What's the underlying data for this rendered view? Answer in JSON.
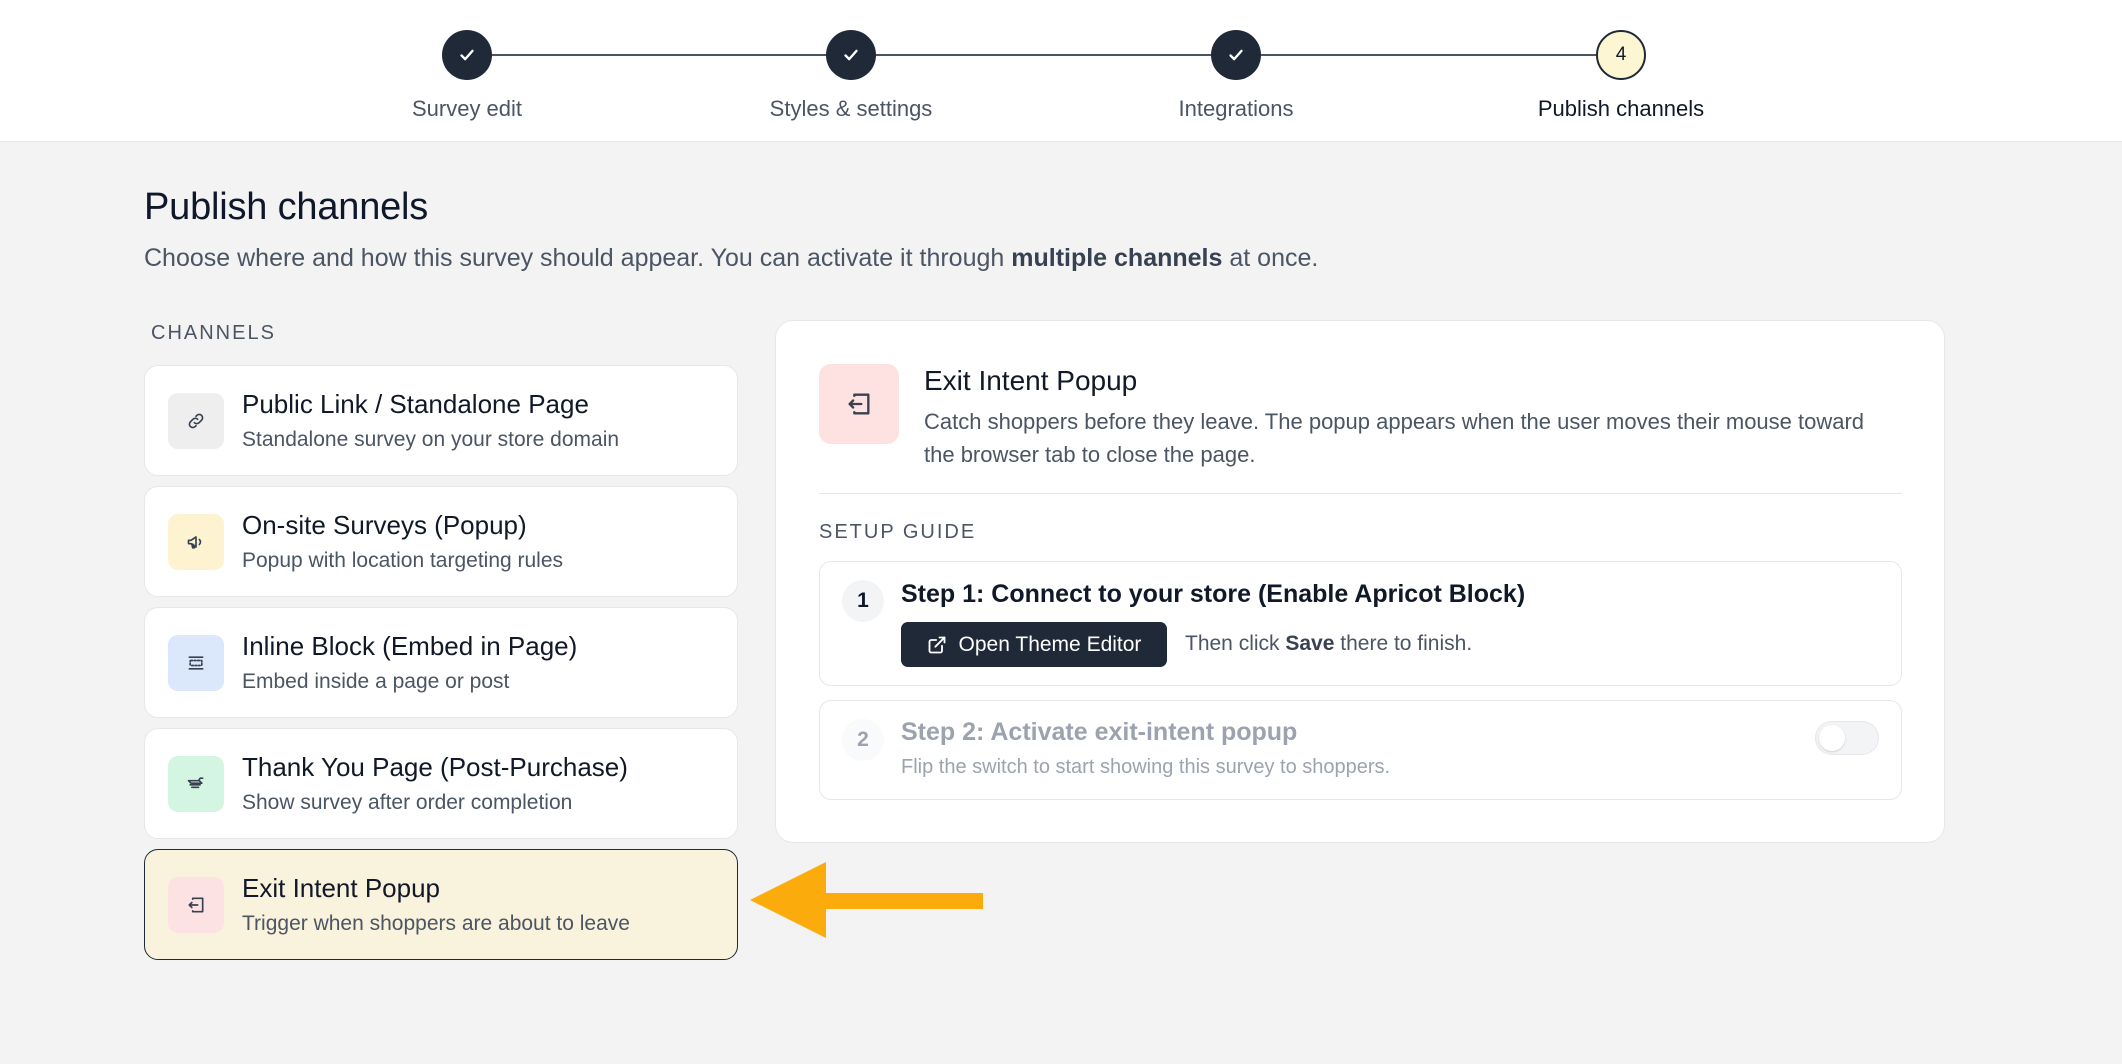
{
  "stepper": {
    "steps": [
      {
        "label": "Survey edit",
        "state": "done"
      },
      {
        "label": "Styles & settings",
        "state": "done"
      },
      {
        "label": "Integrations",
        "state": "done"
      },
      {
        "label": "Publish channels",
        "state": "current",
        "number": "4"
      }
    ]
  },
  "page": {
    "title": "Publish channels",
    "subtitle_before": "Choose where and how this survey should appear. You can activate it through ",
    "subtitle_bold": "multiple channels",
    "subtitle_after": " at once."
  },
  "channels": {
    "heading": "CHANNELS",
    "items": [
      {
        "title": "Public Link / Standalone Page",
        "desc": "Standalone survey on your store domain",
        "icon": "link-icon",
        "icon_bg": "#eeeeee",
        "icon_color": "#374151"
      },
      {
        "title": "On-site Surveys (Popup)",
        "desc": "Popup with location targeting rules",
        "icon": "megaphone-icon",
        "icon_bg": "#fdf3d0",
        "icon_color": "#374151"
      },
      {
        "title": "Inline Block (Embed in Page)",
        "desc": "Embed inside a page or post",
        "icon": "embed-icon",
        "icon_bg": "#dbe7fb",
        "icon_color": "#374151"
      },
      {
        "title": "Thank You Page (Post-Purchase)",
        "desc": "Show survey after order completion",
        "icon": "receipt-icon",
        "icon_bg": "#d5f5e3",
        "icon_color": "#374151"
      },
      {
        "title": "Exit Intent Popup",
        "desc": "Trigger when shoppers are about to leave",
        "icon": "exit-icon",
        "icon_bg": "#fde2e4",
        "icon_color": "#374151",
        "selected": true
      }
    ]
  },
  "panel": {
    "title": "Exit Intent Popup",
    "desc": "Catch shoppers before they leave. The popup appears when the user moves their mouse toward the browser tab to close the page.",
    "setup_heading": "SETUP GUIDE",
    "step1": {
      "number": "1",
      "title": "Step 1: Connect to your store (Enable Apricot Block)",
      "button_label": "Open Theme Editor",
      "hint_before": "Then click ",
      "hint_bold": "Save",
      "hint_after": " there to finish."
    },
    "step2": {
      "number": "2",
      "title": "Step 2: Activate exit-intent popup",
      "desc": "Flip the switch to start showing this survey to shoppers.",
      "toggle_on": false
    }
  },
  "colors": {
    "dark": "#1f2937",
    "accent_arrow": "#fbab0c",
    "selected_bg": "#f9f2dc",
    "current_step_bg": "#fdf6d3"
  }
}
